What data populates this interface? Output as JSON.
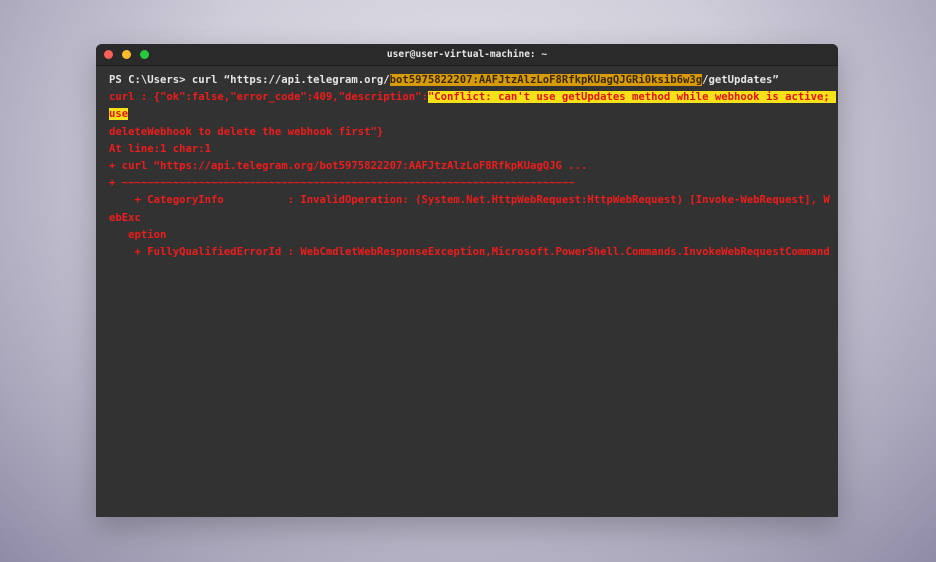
{
  "window": {
    "title": "user@user-virtual-machine: ~",
    "controls": {
      "close": "close-dot",
      "minimize": "minimize-dot",
      "zoom": "zoom-dot"
    }
  },
  "terminal": {
    "cmd": {
      "prefix": "PS C:\\Users> curl “https://api.telegram.org/",
      "token": "bot5975822207:AAFJtzAlzLoF8RfkpKUagQJGRi0ksib6w3g",
      "suffix": "/getUpdates”"
    },
    "response": {
      "prefix": "curl : {\"ok\":false,\"error_code\":409,\"description\":",
      "message": "\"Conflict: can't use getUpdates method while webhook is active; use",
      "continuation": "deleteWebhook to delete the webhook first\"}"
    },
    "error_lines": [
      "At line:1 char:1",
      "+ curl “https://api.telegram.org/bot5975822207:AAFJtzAlzLoF8RfkpKUagQJG ...",
      "+ ~~~~~~~~~~~~~~~~~~~~~~~~~~~~~~~~~~~~~~~~~~~~~~~~~~~~~~~~~~~~~~~~~~~~~~~",
      "    + CategoryInfo          : InvalidOperation: (System.Net.HttpWebRequest:HttpWebRequest) [Invoke-WebRequest], WebExc",
      "   eption",
      "    + FullyQualifiedErrorId : WebCmdletWebResponseException,Microsoft.PowerShell.Commands.InvokeWebRequestCommand"
    ]
  },
  "colors": {
    "terminal_bg": "#323232",
    "error_text": "#ee1c1c",
    "token_highlight": "#d79b08",
    "message_highlight": "#f7e21a"
  }
}
